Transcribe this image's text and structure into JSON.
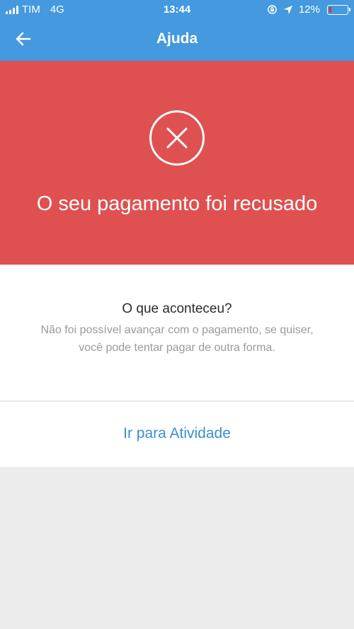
{
  "status_bar": {
    "carrier": "TIM",
    "network": "4G",
    "time": "13:44",
    "battery": "12%",
    "battery_level": 0.12
  },
  "header": {
    "title": "Ajuda",
    "back_icon": "arrow-left-icon"
  },
  "hero": {
    "icon": "close-circle-icon",
    "title": "O seu pagamento foi recusado",
    "background": "#df5150"
  },
  "card": {
    "title": "O que aconteceu?",
    "text": "Não foi possível avançar com o pagamento, se quiser, você pode tentar pagar de outra forma."
  },
  "action": {
    "label": "Ir para Atividade"
  },
  "colors": {
    "header": "#4499df",
    "link": "#3b8fd0"
  }
}
